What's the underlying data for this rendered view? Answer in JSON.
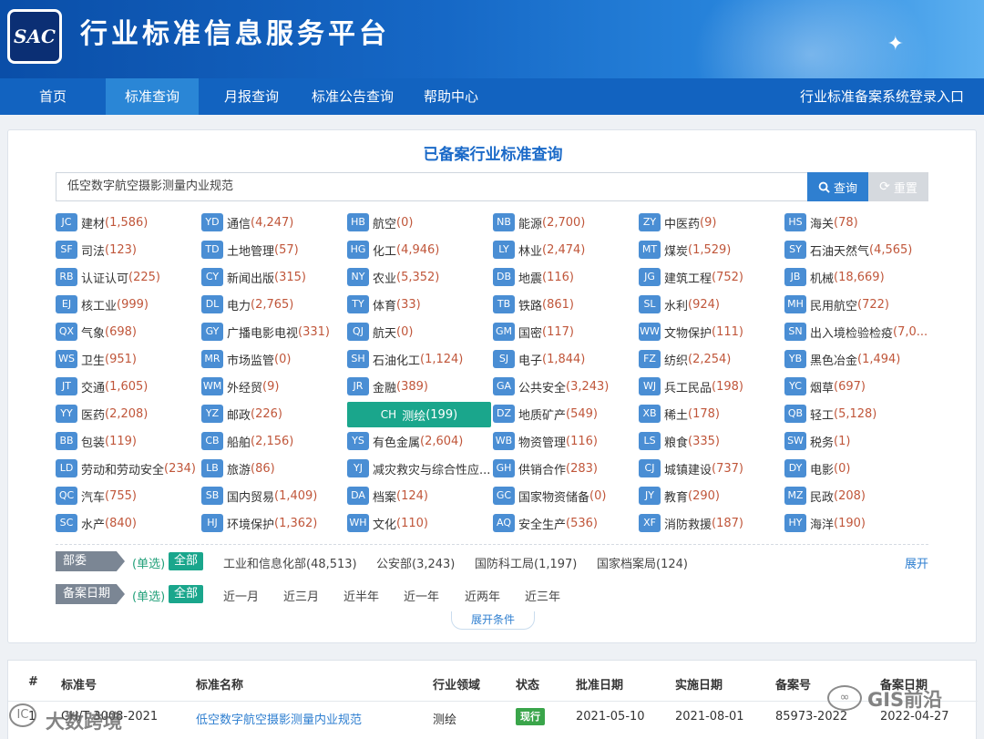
{
  "header": {
    "logo_text": "SAC",
    "site_title": "行业标准信息服务平台"
  },
  "nav": {
    "items": [
      "首页",
      "标准查询",
      "月报查询",
      "标准公告查询",
      "帮助中心"
    ],
    "active": "标准查询",
    "right_link": "行业标准备案系统登录入口"
  },
  "search": {
    "title": "已备案行业标准查询",
    "value": "低空数字航空摄影测量内业规范",
    "query_label": "查询",
    "reset_label": "重置"
  },
  "categories": [
    [
      "JC",
      "建材",
      "(1,586)"
    ],
    [
      "YD",
      "通信",
      "(4,247)"
    ],
    [
      "HB",
      "航空",
      "(0)"
    ],
    [
      "NB",
      "能源",
      "(2,700)"
    ],
    [
      "ZY",
      "中医药",
      "(9)"
    ],
    [
      "HS",
      "海关",
      "(78)"
    ],
    [
      "SF",
      "司法",
      "(123)"
    ],
    [
      "TD",
      "土地管理",
      "(57)"
    ],
    [
      "HG",
      "化工",
      "(4,946)"
    ],
    [
      "LY",
      "林业",
      "(2,474)"
    ],
    [
      "MT",
      "煤炭",
      "(1,529)"
    ],
    [
      "SY",
      "石油天然气",
      "(4,565)"
    ],
    [
      "RB",
      "认证认可",
      "(225)"
    ],
    [
      "CY",
      "新闻出版",
      "(315)"
    ],
    [
      "NY",
      "农业",
      "(5,352)"
    ],
    [
      "DB",
      "地震",
      "(116)"
    ],
    [
      "JG",
      "建筑工程",
      "(752)"
    ],
    [
      "JB",
      "机械",
      "(18,669)"
    ],
    [
      "EJ",
      "核工业",
      "(999)"
    ],
    [
      "DL",
      "电力",
      "(2,765)"
    ],
    [
      "TY",
      "体育",
      "(33)"
    ],
    [
      "TB",
      "铁路",
      "(861)"
    ],
    [
      "SL",
      "水利",
      "(924)"
    ],
    [
      "MH",
      "民用航空",
      "(722)"
    ],
    [
      "QX",
      "气象",
      "(698)"
    ],
    [
      "GY",
      "广播电影电视",
      "(331)"
    ],
    [
      "QJ",
      "航天",
      "(0)"
    ],
    [
      "GM",
      "国密",
      "(117)"
    ],
    [
      "WW",
      "文物保护",
      "(111)"
    ],
    [
      "SN",
      "出入境检验检疫",
      "(7,0..."
    ],
    [
      "WS",
      "卫生",
      "(951)"
    ],
    [
      "MR",
      "市场监管",
      "(0)"
    ],
    [
      "SH",
      "石油化工",
      "(1,124)"
    ],
    [
      "SJ",
      "电子",
      "(1,844)"
    ],
    [
      "FZ",
      "纺织",
      "(2,254)"
    ],
    [
      "YB",
      "黑色冶金",
      "(1,494)"
    ],
    [
      "JT",
      "交通",
      "(1,605)"
    ],
    [
      "WM",
      "外经贸",
      "(9)"
    ],
    [
      "JR",
      "金融",
      "(389)"
    ],
    [
      "GA",
      "公共安全",
      "(3,243)"
    ],
    [
      "WJ",
      "兵工民品",
      "(198)"
    ],
    [
      "YC",
      "烟草",
      "(697)"
    ],
    [
      "YY",
      "医药",
      "(2,208)"
    ],
    [
      "YZ",
      "邮政",
      "(226)"
    ],
    [
      "CH",
      "测绘",
      "(199)"
    ],
    [
      "DZ",
      "地质矿产",
      "(549)"
    ],
    [
      "XB",
      "稀土",
      "(178)"
    ],
    [
      "QB",
      "轻工",
      "(5,128)"
    ],
    [
      "BB",
      "包装",
      "(119)"
    ],
    [
      "CB",
      "船舶",
      "(2,156)"
    ],
    [
      "YS",
      "有色金属",
      "(2,604)"
    ],
    [
      "WB",
      "物资管理",
      "(116)"
    ],
    [
      "LS",
      "粮食",
      "(335)"
    ],
    [
      "SW",
      "税务",
      "(1)"
    ],
    [
      "LD",
      "劳动和劳动安全",
      "(234)"
    ],
    [
      "LB",
      "旅游",
      "(86)"
    ],
    [
      "YJ",
      "减灾救灾与综合性应...",
      ""
    ],
    [
      "GH",
      "供销合作",
      "(283)"
    ],
    [
      "CJ",
      "城镇建设",
      "(737)"
    ],
    [
      "DY",
      "电影",
      "(0)"
    ],
    [
      "QC",
      "汽车",
      "(755)"
    ],
    [
      "SB",
      "国内贸易",
      "(1,409)"
    ],
    [
      "DA",
      "档案",
      "(124)"
    ],
    [
      "GC",
      "国家物资储备",
      "(0)"
    ],
    [
      "JY",
      "教育",
      "(290)"
    ],
    [
      "MZ",
      "民政",
      "(208)"
    ],
    [
      "SC",
      "水产",
      "(840)"
    ],
    [
      "HJ",
      "环境保护",
      "(1,362)"
    ],
    [
      "WH",
      "文化",
      "(110)"
    ],
    [
      "AQ",
      "安全生产",
      "(536)"
    ],
    [
      "XF",
      "消防救援",
      "(187)"
    ],
    [
      "HY",
      "海洋",
      "(190)"
    ]
  ],
  "selected_category": "CH",
  "filters": {
    "ministry": {
      "label": "部委",
      "single": "(单选)",
      "all": "全部",
      "options": [
        "工业和信息化部(48,513)",
        "公安部(3,243)",
        "国防科工局(1,197)",
        "国家档案局(124)"
      ],
      "expand": "展开"
    },
    "date": {
      "label": "备案日期",
      "single": "(单选)",
      "all": "全部",
      "options": [
        "近一月",
        "近三月",
        "近半年",
        "近一年",
        "近两年",
        "近三年"
      ]
    },
    "expand_conditions": "展开条件"
  },
  "table": {
    "headers": [
      "#",
      "标准号",
      "标准名称",
      "行业领域",
      "状态",
      "批准日期",
      "实施日期",
      "备案号",
      "备案日期"
    ],
    "rows": [
      {
        "index": "1",
        "code": "CH/T 3008-2021",
        "name": "低空数字航空摄影测量内业规范",
        "field": "测绘",
        "status": "现行",
        "approve": "2021-05-10",
        "implement": "2021-08-01",
        "record_no": "85973-2022",
        "record_date": "2022-04-27"
      }
    ]
  },
  "watermarks": {
    "left": "大数跨境",
    "right": "GIS前沿",
    "left_badge": "IC",
    "right_badge": "∞"
  }
}
